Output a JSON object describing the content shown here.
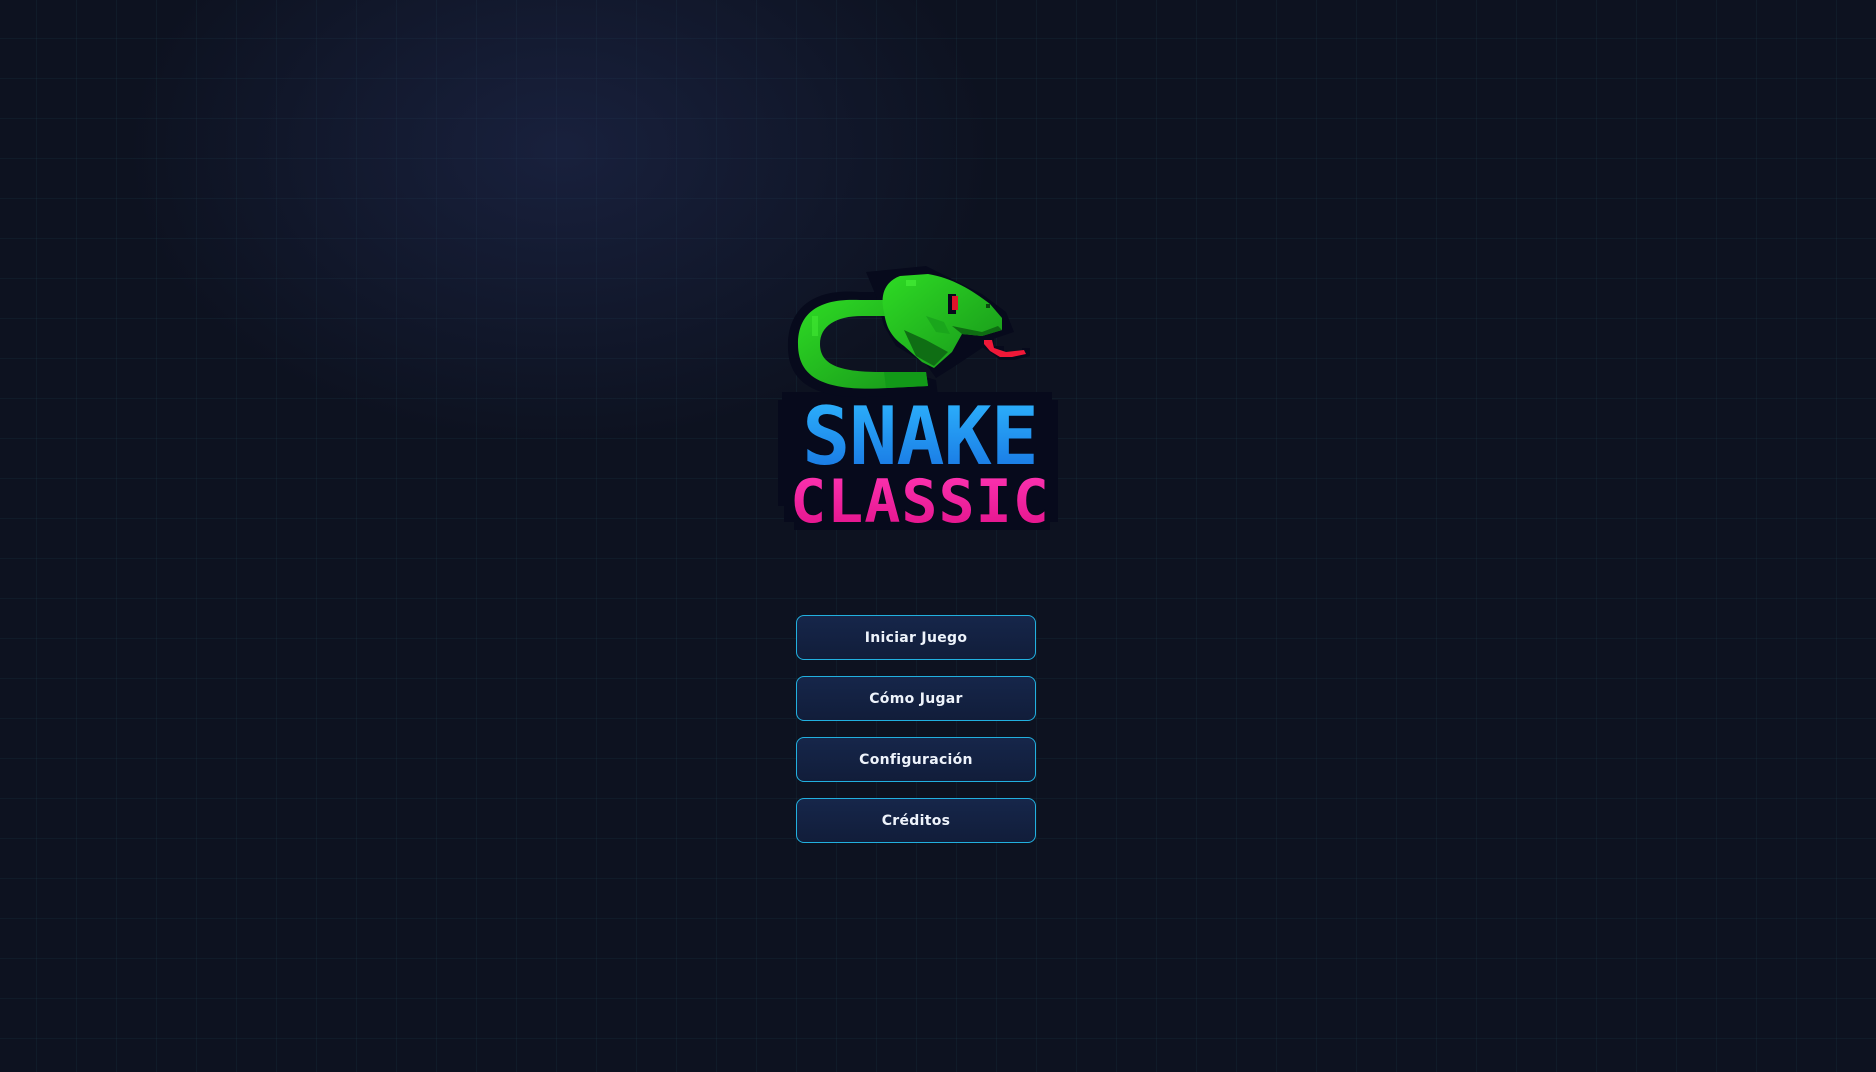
{
  "logo": {
    "line1": "SNAKE",
    "line2": "CLASSIC",
    "colors": {
      "snake_body": "#22c01e",
      "snake_dark": "#0e6d12",
      "eye": "#e0142a",
      "tongue": "#f01838",
      "title_line1": "#1f8fe8",
      "title_line2": "#f0199c",
      "outline": "#06081a"
    }
  },
  "menu": {
    "items": [
      {
        "label": "Iniciar Juego"
      },
      {
        "label": "Cómo Jugar"
      },
      {
        "label": "Configuración"
      },
      {
        "label": "Créditos"
      }
    ]
  },
  "theme": {
    "background": "#0d1220",
    "grid_line": "#1e4a55",
    "button_border": "#22b0df",
    "button_fill": "#14234a",
    "button_text": "#eef3fb"
  }
}
